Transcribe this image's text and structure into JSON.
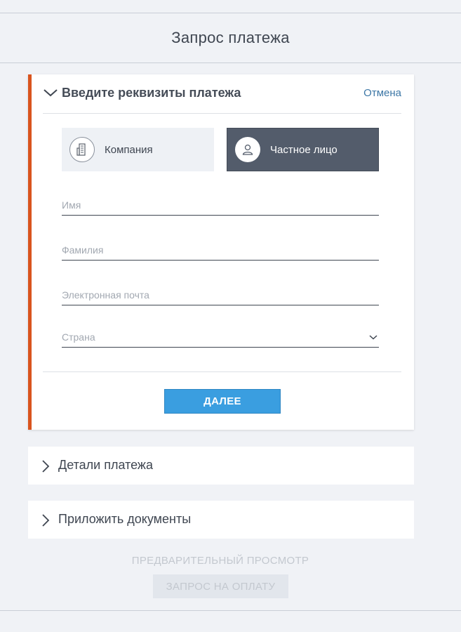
{
  "header": {
    "title": "Запрос платежа"
  },
  "payment_details_panel": {
    "title": "Введите реквизиты платежа",
    "cancel_label": "Отмена",
    "type_options": [
      {
        "label": "Компания",
        "icon": "building-icon",
        "selected": false
      },
      {
        "label": "Частное лицо",
        "icon": "person-icon",
        "selected": true
      }
    ],
    "fields": {
      "first_name": {
        "placeholder": "Имя",
        "value": ""
      },
      "last_name": {
        "placeholder": "Фамилия",
        "value": ""
      },
      "email": {
        "placeholder": "Электронная почта",
        "value": ""
      },
      "country": {
        "placeholder": "Страна",
        "value": ""
      }
    },
    "next_label": "ДАЛЕЕ"
  },
  "sections": [
    {
      "label": "Детали платежа",
      "expanded": false
    },
    {
      "label": "Приложить документы",
      "expanded": false
    }
  ],
  "footer": {
    "preview_label": "ПРЕДВАРИТЕЛЬНЫЙ ПРОСМОТР",
    "request_label": "ЗАПРОС НА ОПЛАТУ"
  },
  "colors": {
    "accent_border": "#d9541e",
    "primary_button": "#3a9ee0",
    "selected_option": "#535c6b",
    "link": "#3d77a6",
    "disabled_text": "#c3c8cf"
  }
}
